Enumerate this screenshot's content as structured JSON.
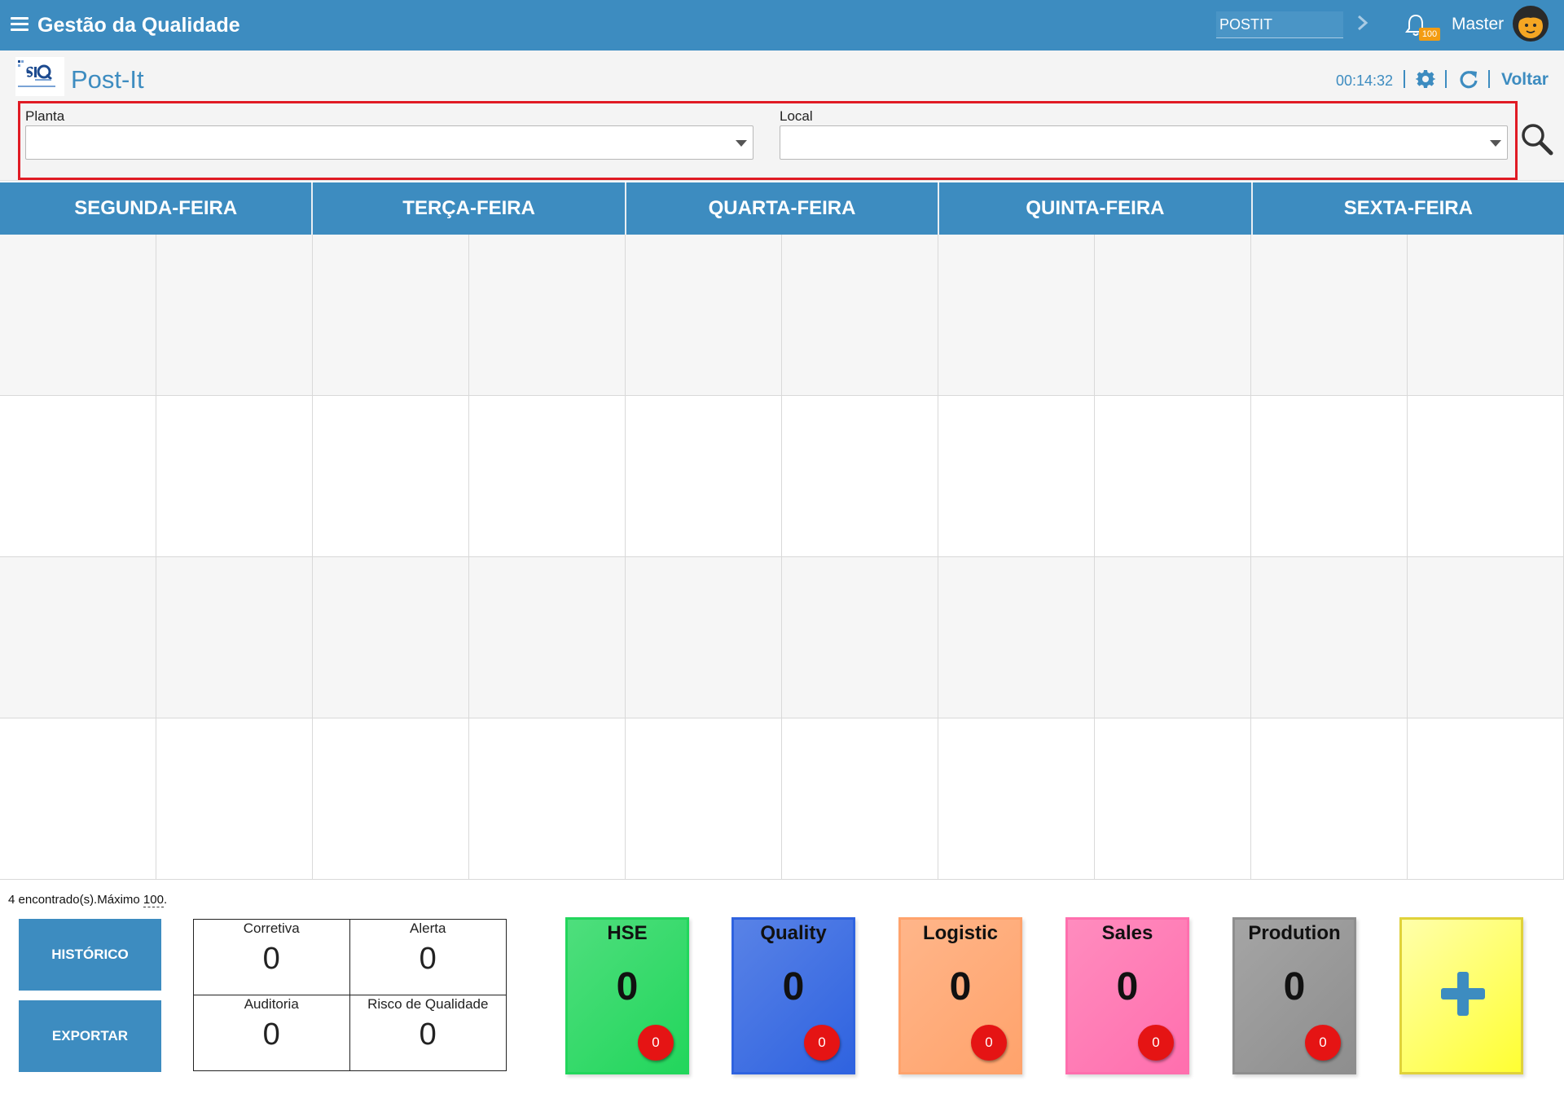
{
  "topbar": {
    "title": "Gestão da Qualidade",
    "module_value": "POSTIT",
    "notification_count": "100",
    "user_name": "Master"
  },
  "header": {
    "page_title": "Post-It",
    "timer": "00:14:32",
    "back_label": "Voltar"
  },
  "filters": {
    "planta_label": "Planta",
    "local_label": "Local"
  },
  "week": {
    "days": [
      "SEGUNDA-FEIRA",
      "TERÇA-FEIRA",
      "QUARTA-FEIRA",
      "QUINTA-FEIRA",
      "SEXTA-FEIRA"
    ]
  },
  "footer": {
    "found_prefix": "4 encontrado(s).Máximo ",
    "found_max": "100",
    "found_suffix": ".",
    "historico_label": "HISTÓRICO",
    "exportar_label": "EXPORTAR",
    "counters": [
      {
        "label": "Corretiva",
        "value": "0"
      },
      {
        "label": "Alerta",
        "value": "0"
      },
      {
        "label": "Auditoria",
        "value": "0"
      },
      {
        "label": "Risco de Qualidade",
        "value": "0"
      }
    ],
    "cards": [
      {
        "title": "HSE",
        "value": "0",
        "badge": "0",
        "color": "#22d65c"
      },
      {
        "title": "Quality",
        "value": "0",
        "badge": "0",
        "color": "#2f63e0"
      },
      {
        "title": "Logistic",
        "value": "0",
        "badge": "0",
        "color": "#ffa36c"
      },
      {
        "title": "Sales",
        "value": "0",
        "badge": "0",
        "color": "#ff6fae"
      },
      {
        "title": "Prodution",
        "value": "0",
        "badge": "0",
        "color": "#8e8e8e"
      }
    ],
    "add_card_color": "#ffff33"
  },
  "colors": {
    "primary": "#3d8cc0",
    "filter_border": "#e01b24",
    "badge": "#e51414"
  }
}
